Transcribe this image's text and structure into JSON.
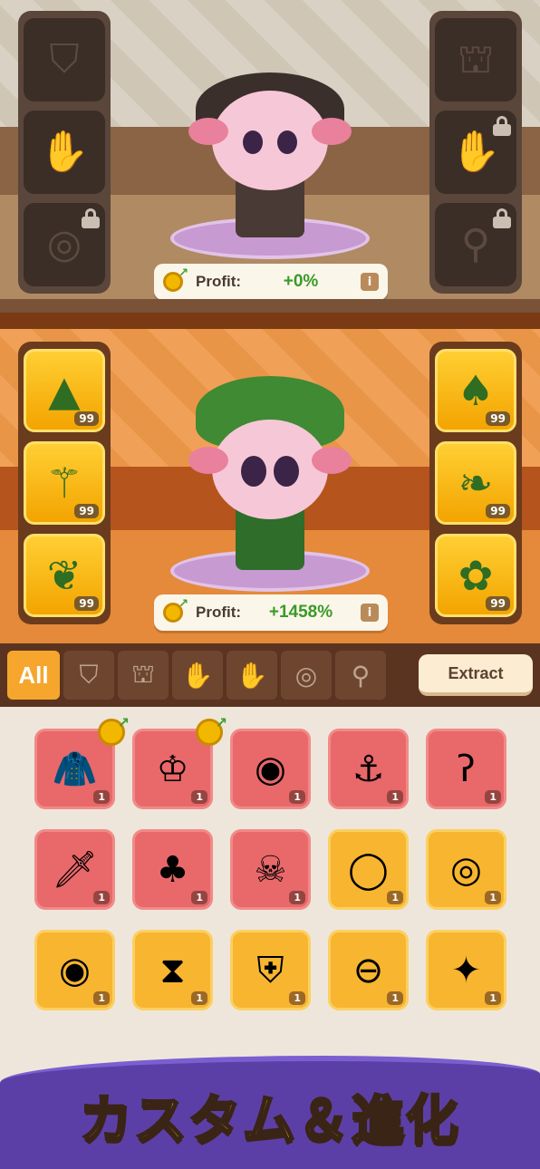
{
  "top_panel": {
    "left_slots": [
      {
        "icon": "hat-icon",
        "glyph": "⛉",
        "locked": false
      },
      {
        "icon": "glove-icon",
        "glyph": "✋",
        "locked": false
      },
      {
        "icon": "ring-icon",
        "glyph": "◎",
        "locked": true
      }
    ],
    "right_slots": [
      {
        "icon": "cloak-icon",
        "glyph": "⛫",
        "locked": false
      },
      {
        "icon": "glove-icon",
        "glyph": "✋",
        "locked": true
      },
      {
        "icon": "necklace-icon",
        "glyph": "⚲",
        "locked": true
      }
    ],
    "profit_label": "Profit:",
    "profit_value": "+0%"
  },
  "bottom_panel": {
    "left_slots": [
      {
        "icon": "leaf-hat-icon",
        "glyph": "▲",
        "count": "99"
      },
      {
        "icon": "leaf-staff-icon",
        "glyph": "⚚",
        "count": "99"
      },
      {
        "icon": "leaf-glove-icon",
        "glyph": "❦",
        "count": "99"
      }
    ],
    "right_slots": [
      {
        "icon": "leaf-cloak-icon",
        "glyph": "♠",
        "count": "99"
      },
      {
        "icon": "leaf-charm-icon",
        "glyph": "❧",
        "count": "99"
      },
      {
        "icon": "leaf-collar-icon",
        "glyph": "✿",
        "count": "99"
      }
    ],
    "profit_label": "Profit:",
    "profit_value": "+1458%"
  },
  "tabs": [
    {
      "label": "All",
      "icon": "",
      "active": true
    },
    {
      "label": "",
      "icon": "hat-tab-icon",
      "glyph": "⛉"
    },
    {
      "label": "",
      "icon": "cloak-tab-icon",
      "glyph": "⛫"
    },
    {
      "label": "",
      "icon": "glove-tab-icon",
      "glyph": "✋"
    },
    {
      "label": "",
      "icon": "hand-tab-icon",
      "glyph": "✋"
    },
    {
      "label": "",
      "icon": "ring-tab-icon",
      "glyph": "◎"
    },
    {
      "label": "",
      "icon": "necklace-tab-icon",
      "glyph": "⚲"
    }
  ],
  "extract_label": "Extract",
  "inventory": [
    {
      "name": "cloak-item",
      "glyph": "🧥",
      "qty": "1",
      "color": "red",
      "upgrade": true
    },
    {
      "name": "crown-item",
      "glyph": "♔",
      "qty": "1",
      "color": "red",
      "upgrade": true
    },
    {
      "name": "skull-ring-item",
      "glyph": "◉",
      "qty": "1",
      "color": "red",
      "upgrade": false
    },
    {
      "name": "anchor-collar-item",
      "glyph": "⚓",
      "qty": "1",
      "color": "red",
      "upgrade": false
    },
    {
      "name": "hook-item",
      "glyph": "ʔ",
      "qty": "1",
      "color": "red",
      "upgrade": false
    },
    {
      "name": "dagger-item",
      "glyph": "🗡",
      "qty": "1",
      "color": "red",
      "upgrade": false
    },
    {
      "name": "dark-cloak-item",
      "glyph": "♣",
      "qty": "1",
      "color": "red",
      "upgrade": false
    },
    {
      "name": "pirate-hat-item",
      "glyph": "☠",
      "qty": "1",
      "color": "red",
      "upgrade": false
    },
    {
      "name": "ice-ring-item",
      "glyph": "◯",
      "qty": "1",
      "color": "gold",
      "upgrade": false
    },
    {
      "name": "steel-ring-item",
      "glyph": "◎",
      "qty": "1",
      "color": "gold",
      "upgrade": false
    },
    {
      "name": "gold-ring-item",
      "glyph": "◉",
      "qty": "1",
      "color": "gold",
      "upgrade": false
    },
    {
      "name": "ascot-item",
      "glyph": "⧗",
      "qty": "1",
      "color": "gold",
      "upgrade": false
    },
    {
      "name": "shield-ring-item",
      "glyph": "⛨",
      "qty": "1",
      "color": "gold",
      "upgrade": false
    },
    {
      "name": "red-collar-item",
      "glyph": "⊖",
      "qty": "1",
      "color": "gold",
      "upgrade": false
    },
    {
      "name": "horn-item",
      "glyph": "✦",
      "qty": "1",
      "color": "gold",
      "upgrade": false
    }
  ],
  "banner_text": "カスタム＆進化",
  "colors": {
    "accent": "#f6a62c",
    "profit_green": "#3a9a28",
    "banner_bg": "#5c3fa6",
    "banner_text": "#ffd43a"
  }
}
